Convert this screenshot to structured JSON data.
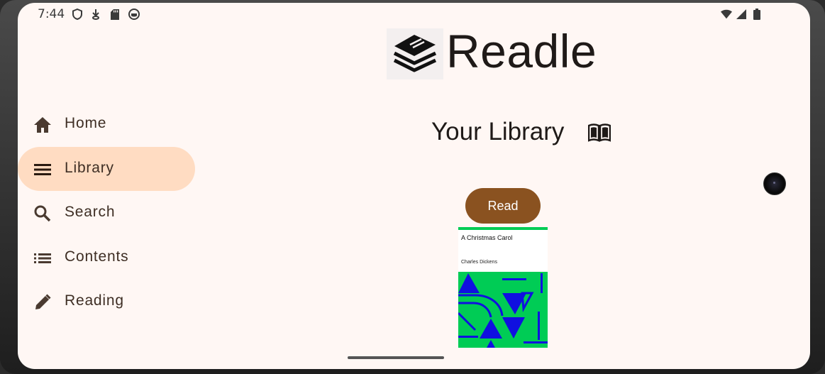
{
  "status_bar": {
    "time": "7:44",
    "left_icons": [
      "shield-icon",
      "download-icon",
      "sd-card-icon",
      "app-icon"
    ],
    "right_icons": [
      "wifi-icon",
      "cell-signal-icon",
      "battery-icon"
    ]
  },
  "app": {
    "name": "Readle",
    "logo_icon": "stacked-books-icon"
  },
  "nav": {
    "items": [
      {
        "label": "Home",
        "icon": "home-icon",
        "active": false
      },
      {
        "label": "Library",
        "icon": "menu-icon",
        "active": true
      },
      {
        "label": "Search",
        "icon": "search-icon",
        "active": false
      },
      {
        "label": "Contents",
        "icon": "list-icon",
        "active": false
      },
      {
        "label": "Reading",
        "icon": "pencil-icon",
        "active": false
      }
    ]
  },
  "main": {
    "title": "Your Library",
    "title_icon": "open-book-icon",
    "read_button": "Read",
    "book": {
      "title": "A Christmas Carol",
      "author": "Charles Dickens"
    }
  },
  "colors": {
    "background": "#fff7f4",
    "nav_active": "#ffdcc2",
    "read_button": "#8a5220",
    "cover_green": "#00cc55",
    "cover_blue": "#1010e0"
  }
}
